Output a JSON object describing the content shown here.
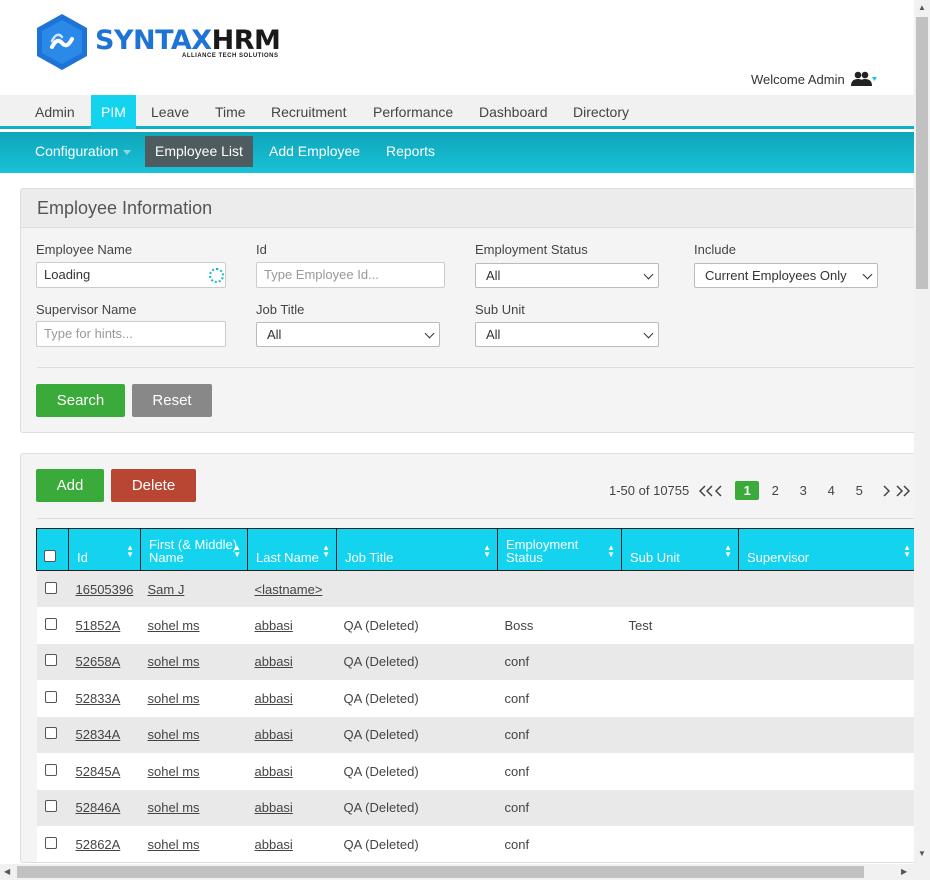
{
  "brand": {
    "syntax": "SYNTAX",
    "hrm": "HRM",
    "tagline": "ALLIANCE TECH SOLUTIONS",
    "color": "#1e74d6"
  },
  "welcome": {
    "text": "Welcome Admin",
    "icon": "users-icon"
  },
  "mainnav": [
    "Admin",
    "PIM",
    "Leave",
    "Time",
    "Recruitment",
    "Performance",
    "Dashboard",
    "Directory"
  ],
  "subnav": {
    "configuration": "Configuration",
    "employee_list": "Employee List",
    "add_employee": "Add Employee",
    "reports": "Reports"
  },
  "filter": {
    "title": "Employee Information",
    "employee_name_label": "Employee Name",
    "employee_name_value": "Loading",
    "id_label": "Id",
    "id_placeholder": "Type Employee Id...",
    "employment_status_label": "Employment Status",
    "employment_status_value": "All",
    "include_label": "Include",
    "include_value": "Current Employees Only",
    "supervisor_label": "Supervisor Name",
    "supervisor_placeholder": "Type for hints...",
    "job_title_label": "Job Title",
    "job_title_value": "All",
    "sub_unit_label": "Sub Unit",
    "sub_unit_value": "All",
    "search": "Search",
    "reset": "Reset"
  },
  "list": {
    "add": "Add",
    "delete": "Delete",
    "range": "1-50 of 10755",
    "pages": [
      "1",
      "2",
      "3",
      "4",
      "5"
    ],
    "columns": [
      "Id",
      "First (& Middle) Name",
      "Last Name",
      "Job Title",
      "Employment Status",
      "Sub Unit",
      "Supervisor"
    ],
    "rows": [
      {
        "id": "16505396",
        "first": "Sam J",
        "last": "<lastname>",
        "job": "",
        "status": "",
        "unit": "",
        "supervisor": ""
      },
      {
        "id": "51852A",
        "first": "sohel ms",
        "last": "abbasi",
        "job": "QA (Deleted)",
        "status": "Boss",
        "unit": "Test",
        "supervisor": ""
      },
      {
        "id": "52658A",
        "first": "sohel ms",
        "last": "abbasi",
        "job": "QA (Deleted)",
        "status": "conf",
        "unit": "",
        "supervisor": ""
      },
      {
        "id": "52833A",
        "first": "sohel ms",
        "last": "abbasi",
        "job": "QA (Deleted)",
        "status": "conf",
        "unit": "",
        "supervisor": ""
      },
      {
        "id": "52834A",
        "first": "sohel ms",
        "last": "abbasi",
        "job": "QA (Deleted)",
        "status": "conf",
        "unit": "",
        "supervisor": ""
      },
      {
        "id": "52845A",
        "first": "sohel ms",
        "last": "abbasi",
        "job": "QA (Deleted)",
        "status": "conf",
        "unit": "",
        "supervisor": ""
      },
      {
        "id": "52846A",
        "first": "sohel ms",
        "last": "abbasi",
        "job": "QA (Deleted)",
        "status": "conf",
        "unit": "",
        "supervisor": ""
      },
      {
        "id": "52862A",
        "first": "sohel ms",
        "last": "abbasi",
        "job": "QA (Deleted)",
        "status": "conf",
        "unit": "",
        "supervisor": ""
      }
    ]
  },
  "colors": {
    "accent": "#14d3ee",
    "green": "#3aaa3a",
    "delete": "#b84632"
  }
}
